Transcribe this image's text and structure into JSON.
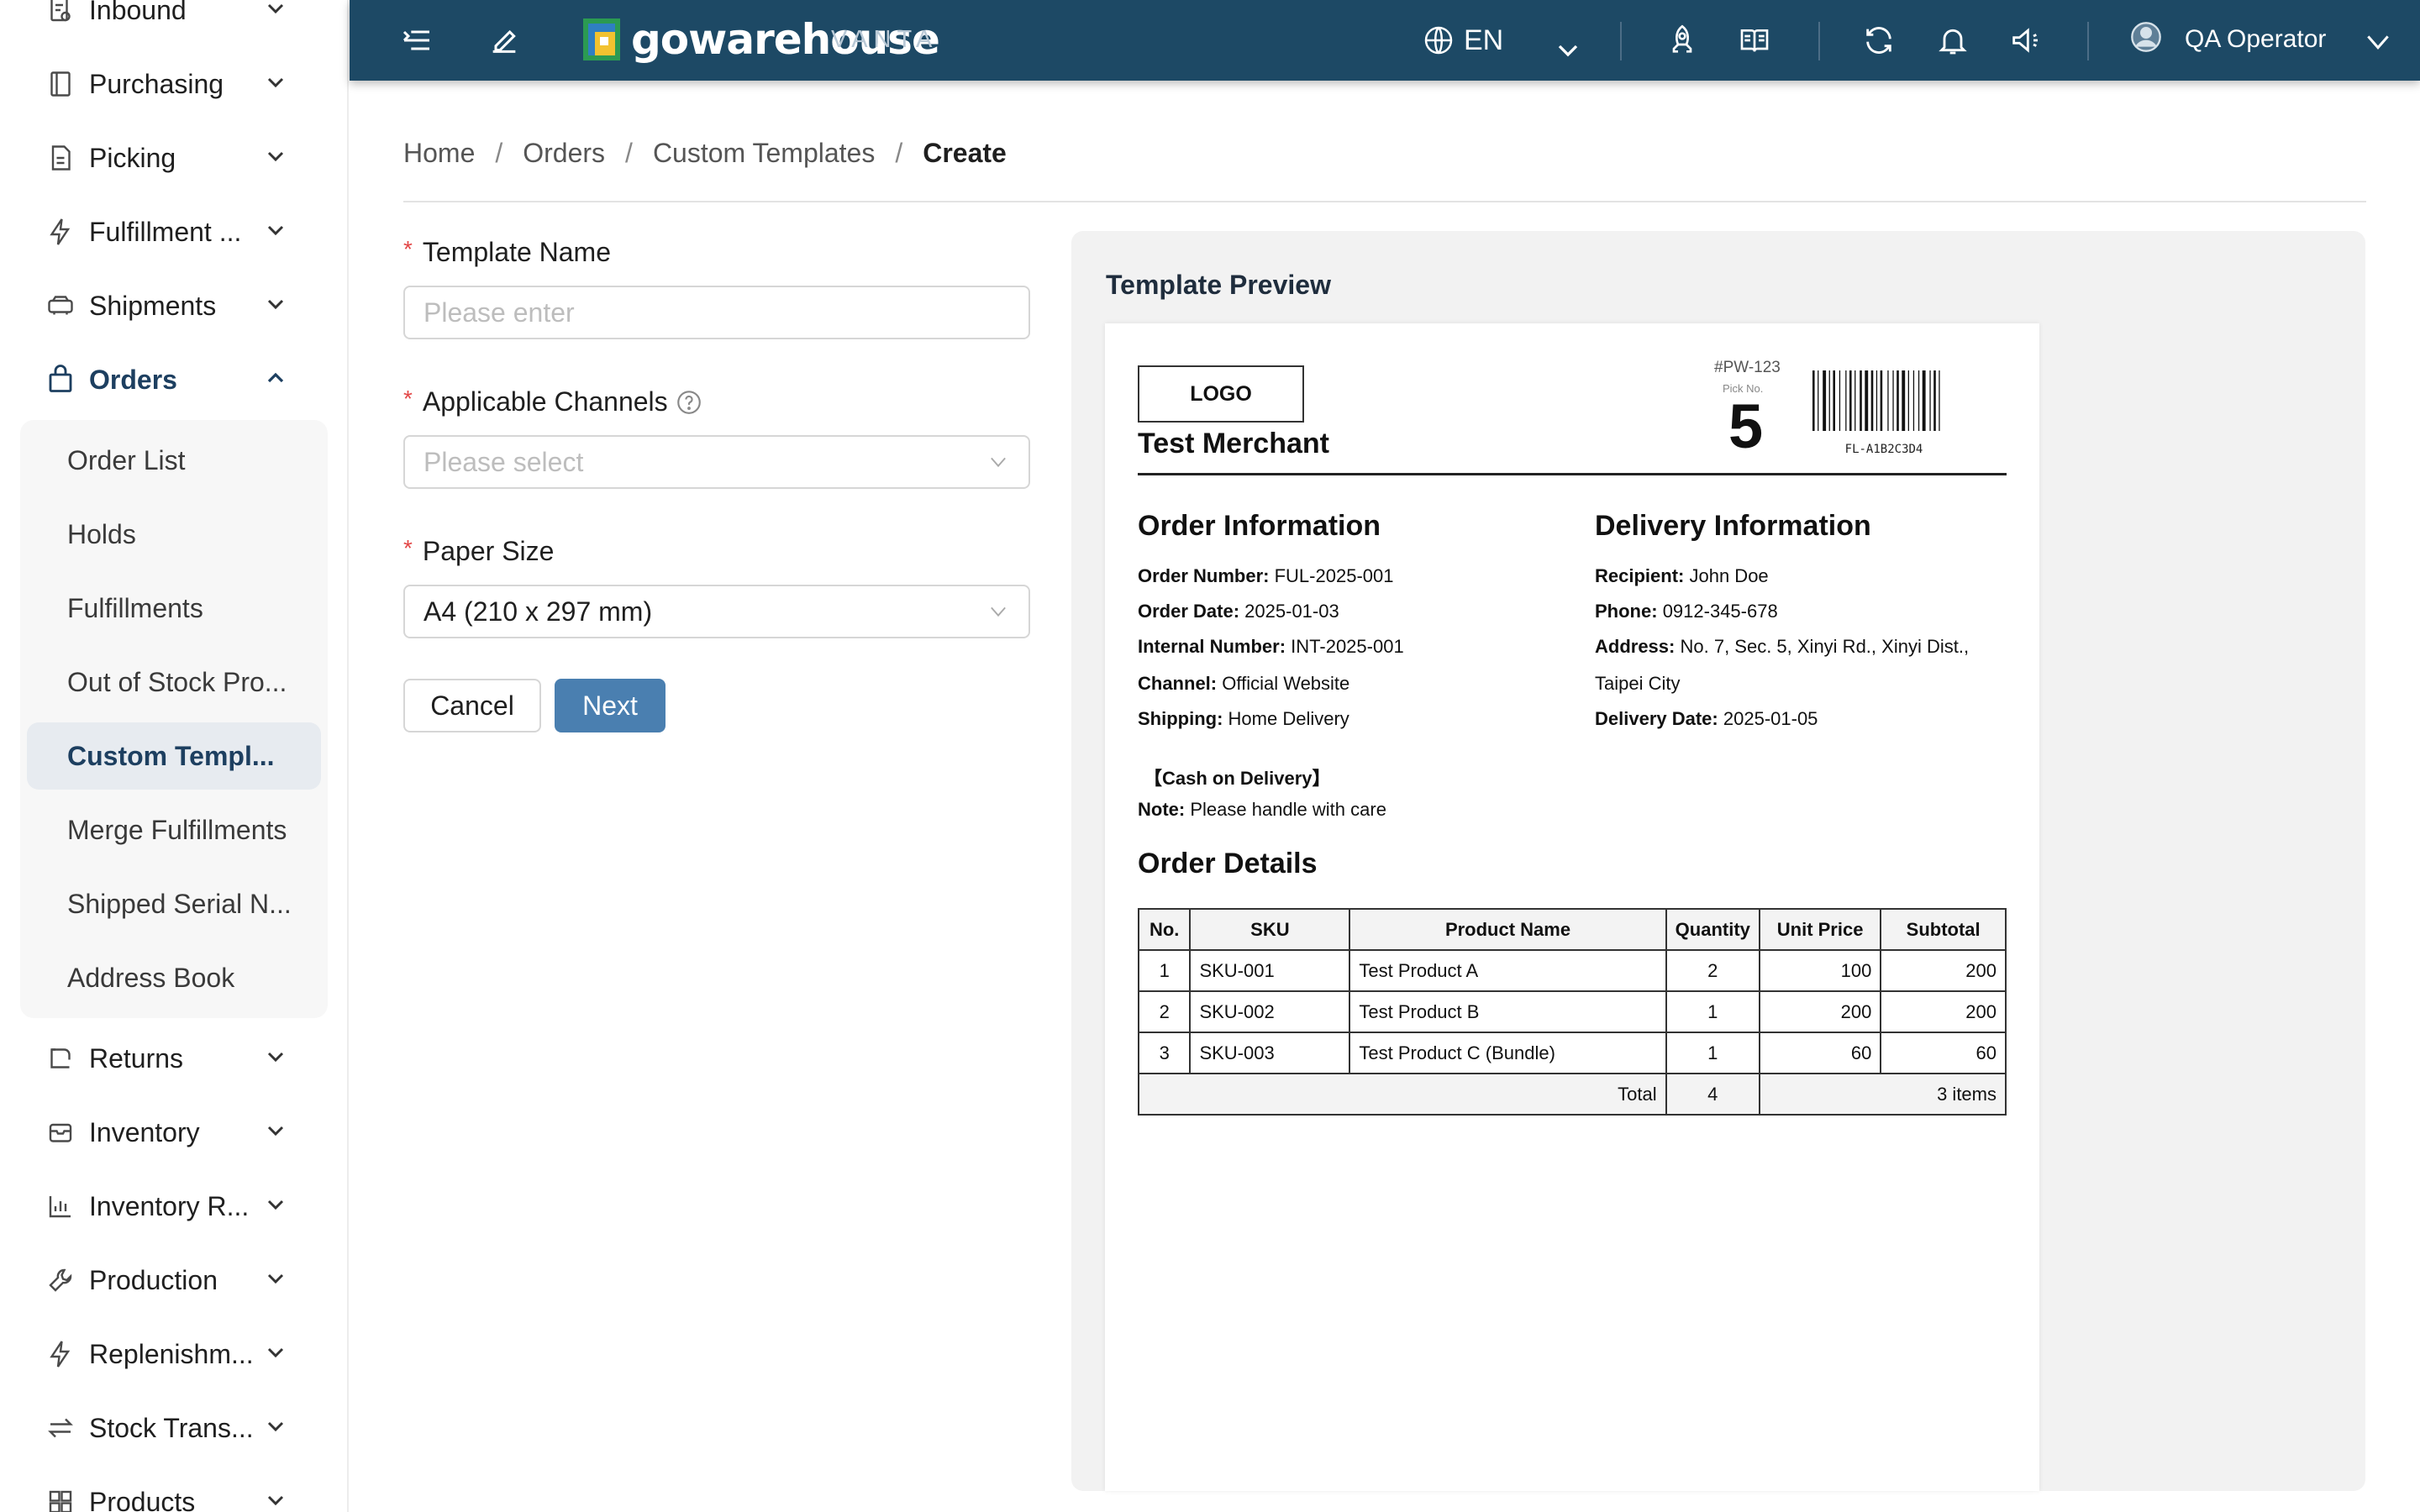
{
  "sidebar": {
    "items": [
      {
        "label": "Inbound",
        "icon": "inbound-icon"
      },
      {
        "label": "Purchasing",
        "icon": "purchasing-icon"
      },
      {
        "label": "Picking",
        "icon": "picking-icon"
      },
      {
        "label": "Fulfillment ...",
        "icon": "lightning-icon"
      },
      {
        "label": "Shipments",
        "icon": "truck-icon"
      },
      {
        "label": "Orders",
        "icon": "bag-icon"
      },
      {
        "label": "Returns",
        "icon": "return-icon"
      },
      {
        "label": "Inventory",
        "icon": "box-icon"
      },
      {
        "label": "Inventory R...",
        "icon": "chart-icon"
      },
      {
        "label": "Production",
        "icon": "wrench-icon"
      },
      {
        "label": "Replenishm...",
        "icon": "lightning-icon"
      },
      {
        "label": "Stock Trans...",
        "icon": "transfer-icon"
      },
      {
        "label": "Products",
        "icon": "grid-icon"
      }
    ],
    "orders_submenu": [
      "Order List",
      "Holds",
      "Fulfillments",
      "Out of Stock Pro...",
      "Custom Templ...",
      "Merge Fulfillments",
      "Shipped Serial N...",
      "Address Book"
    ],
    "active_item": "Orders",
    "active_subitem": "Custom Templ..."
  },
  "header": {
    "brand_word": "gowarehouse",
    "brand_sub": "VANTA",
    "language": "EN",
    "user_name": "QA Operator",
    "bg_color": "#1d4965"
  },
  "breadcrumb": [
    "Home",
    "Orders",
    "Custom Templates",
    "Create"
  ],
  "form": {
    "template_name": {
      "label": "Template Name",
      "placeholder": "Please enter",
      "value": ""
    },
    "channels": {
      "label": "Applicable Channels",
      "placeholder": "Please select"
    },
    "paper_size": {
      "label": "Paper Size",
      "value": "A4 (210 x 297 mm)"
    },
    "cancel_label": "Cancel",
    "next_label": "Next",
    "required_mark": "*"
  },
  "preview": {
    "title": "Template Preview",
    "logo": "LOGO",
    "merchant": "Test Merchant",
    "pw_code": "#PW-123",
    "pick_label": "Pick No.",
    "pick_no": "5",
    "barcode_text": "FL-A1B2C3D4",
    "order_info": {
      "title": "Order Information",
      "fields": [
        {
          "k": "Order Number:",
          "v": "FUL-2025-001"
        },
        {
          "k": "Order Date:",
          "v": "2025-01-03"
        },
        {
          "k": "Internal Number:",
          "v": "INT-2025-001"
        },
        {
          "k": "Channel:",
          "v": "Official Website"
        },
        {
          "k": "Shipping:",
          "v": "Home Delivery"
        }
      ],
      "cod": "【Cash on Delivery】",
      "note_k": "Note:",
      "note_v": "Please handle with care"
    },
    "delivery_info": {
      "title": "Delivery Information",
      "recipient_k": "Recipient:",
      "recipient_v": "John Doe",
      "phone_k": "Phone:",
      "phone_v": "0912-345-678",
      "address_k": "Address:",
      "address_v1": "No. 7, Sec. 5, Xinyi Rd., Xinyi Dist.,",
      "address_v2": "Taipei City",
      "date_k": "Delivery Date:",
      "date_v": "2025-01-05"
    },
    "details": {
      "title": "Order Details",
      "columns": [
        "No.",
        "SKU",
        "Product Name",
        "Quantity",
        "Unit Price",
        "Subtotal"
      ],
      "rows": [
        [
          "1",
          "SKU-001",
          "Test Product A",
          "2",
          "100",
          "200"
        ],
        [
          "2",
          "SKU-002",
          "Test Product B",
          "1",
          "200",
          "200"
        ],
        [
          "3",
          "SKU-003",
          "Test Product C (Bundle)",
          "1",
          "60",
          "60"
        ]
      ],
      "total_label": "Total",
      "total_qty": "4",
      "total_items": "3 items"
    }
  }
}
